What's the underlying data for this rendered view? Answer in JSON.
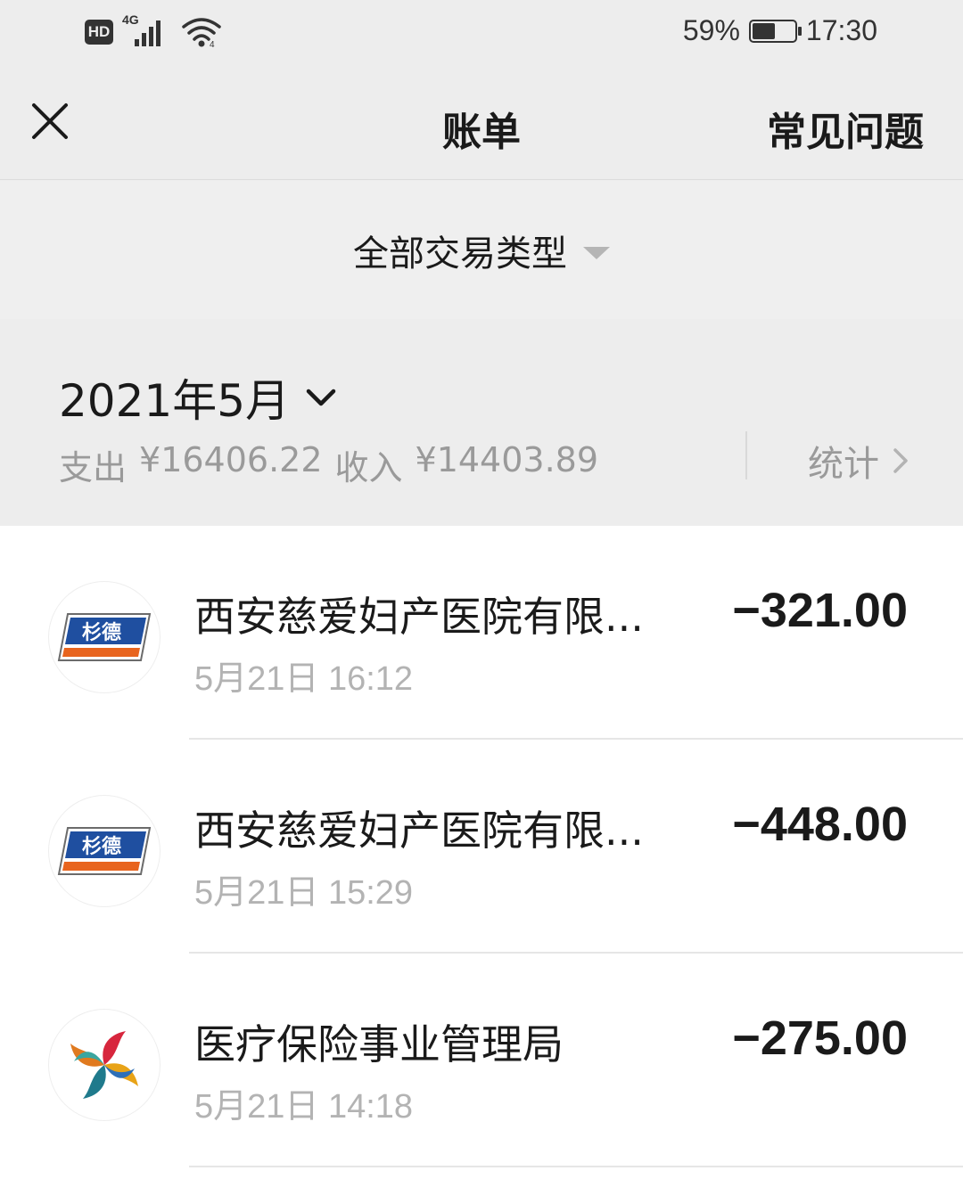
{
  "status_bar": {
    "hd": "HD",
    "network": "4G",
    "battery": "59%",
    "time": "17:30"
  },
  "nav": {
    "title": "账单",
    "faq": "常见问题"
  },
  "filter": {
    "label": "全部交易类型"
  },
  "month": {
    "label": "2021年5月",
    "expense_label": "支出",
    "expense": "¥16406.22",
    "income_label": "收入",
    "income": "¥14403.89",
    "stats": "统计"
  },
  "transactions": [
    {
      "merchant": "西安慈爱妇产医院有限...",
      "time": "5月21日 16:12",
      "amount": "−321.00",
      "logo": "sand-logo",
      "logo_text": "杉德"
    },
    {
      "merchant": "西安慈爱妇产医院有限...",
      "time": "5月21日 15:29",
      "amount": "−448.00",
      "logo": "sand-logo",
      "logo_text": "杉德"
    },
    {
      "merchant": "医疗保险事业管理局",
      "time": "5月21日 14:18",
      "amount": "−275.00",
      "logo": "medical-insurance-logo"
    }
  ],
  "colors": {
    "background": "#ededed",
    "list_background": "#ffffff",
    "muted_text": "#9a9a9a",
    "sand_blue": "#1f4fa0",
    "sand_orange": "#e8641e"
  }
}
